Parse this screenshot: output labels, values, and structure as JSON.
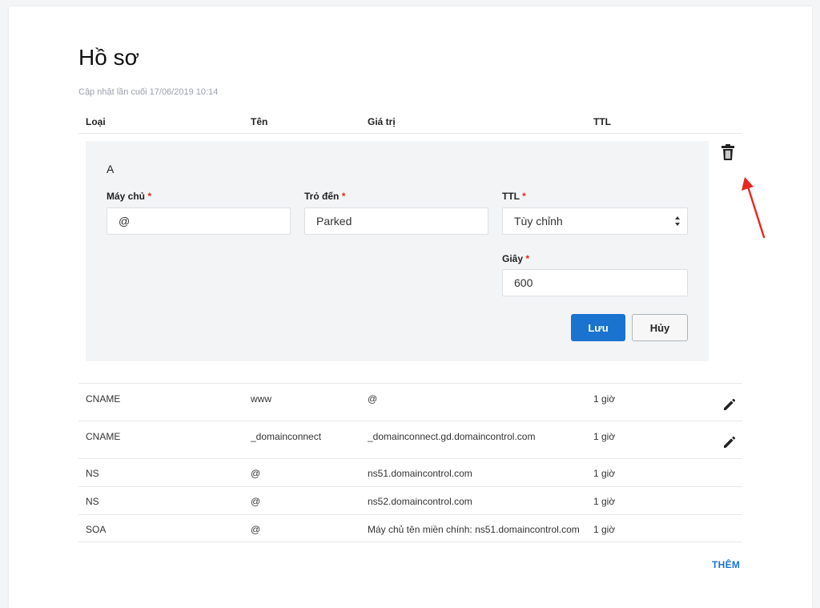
{
  "page": {
    "title": "Hồ sơ",
    "last_updated": "Cập nhật lần cuối 17/06/2019 10:14"
  },
  "table_header": {
    "type": "Loại",
    "name": "Tên",
    "value": "Giá trị",
    "ttl": "TTL"
  },
  "edit_form": {
    "record_type": "A",
    "host_label": "Máy chủ",
    "host_value": "@",
    "points_to_label": "Trỏ đến",
    "points_to_value": "Parked",
    "ttl_label": "TTL",
    "ttl_selected": "Tùy chỉnh",
    "seconds_label": "Giây",
    "seconds_value": "600",
    "required_mark": "*",
    "save_label": "Lưu",
    "cancel_label": "Hủy"
  },
  "records": [
    {
      "type": "CNAME",
      "name": "www",
      "value": "@",
      "ttl": "1 giờ"
    },
    {
      "type": "CNAME",
      "name": "_domainconnect",
      "value": "_domainconnect.gd.domaincontrol.com",
      "ttl": "1 giờ"
    },
    {
      "type": "NS",
      "name": "@",
      "value": "ns51.domaincontrol.com",
      "ttl": "1 giờ"
    },
    {
      "type": "NS",
      "name": "@",
      "value": "ns52.domaincontrol.com",
      "ttl": "1 giờ"
    },
    {
      "type": "SOA",
      "name": "@",
      "value": "Máy chủ tên miền chính: ns51.domaincontrol.com",
      "ttl": "1 giờ"
    }
  ],
  "actions": {
    "add_label": "THÊM"
  },
  "icons": {
    "delete": "trash-icon",
    "edit": "pencil-icon",
    "select": "select-arrows-icon"
  },
  "colors": {
    "primary": "#1a73cf",
    "required": "#e0281f",
    "annotation": "#e8261c",
    "panel_bg": "#f3f4f6"
  }
}
